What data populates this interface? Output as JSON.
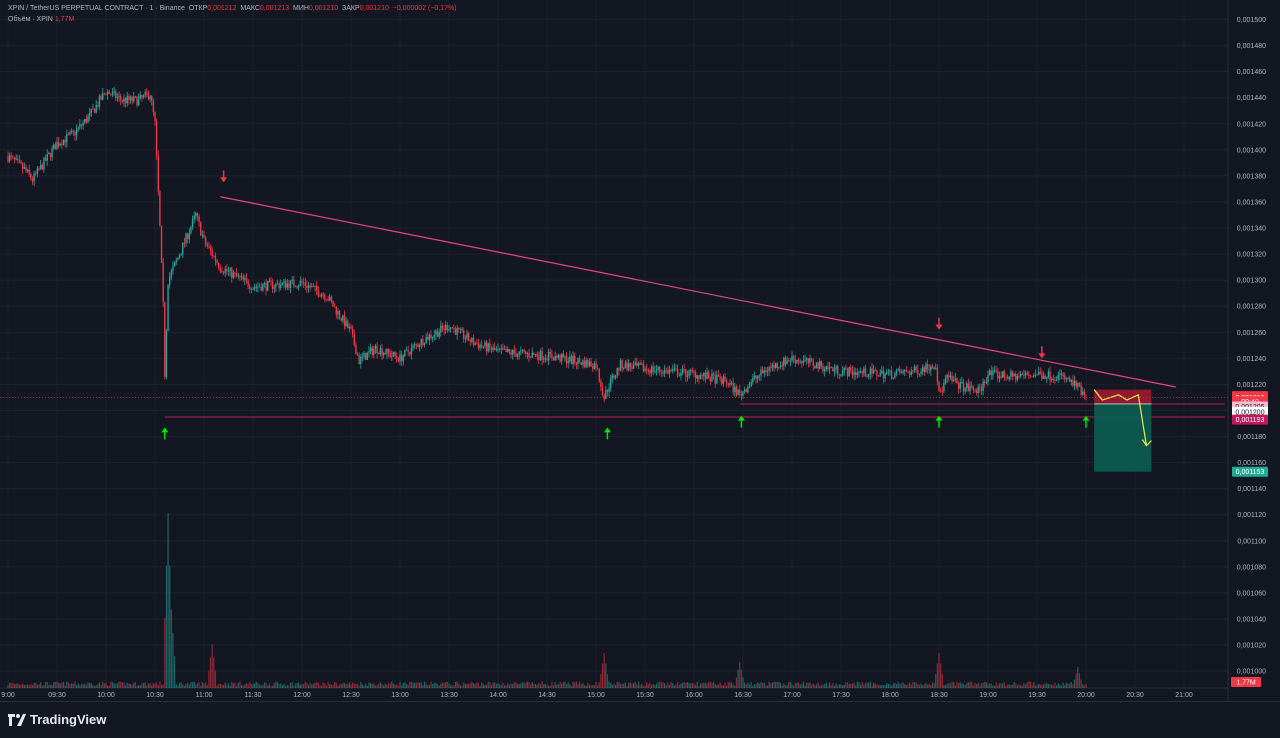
{
  "header": {
    "symbol": "XPIN / TetherUS PERPETUAL CONTRACT · 1 · Binance",
    "open_label": "ОТКР",
    "open_value": "0,001212",
    "high_label": "МАКС",
    "high_value": "0,001213",
    "low_label": "МИН",
    "low_value": "0,001210",
    "close_label": "ЗАКР",
    "close_value": "0,001210",
    "change": "−0,000002 (−0,17%)",
    "volume_label": "Объём · XPIN",
    "volume_value": "1,77M"
  },
  "brand": {
    "name": "TradingView",
    "icon": "tradingview-logo-icon"
  },
  "colors": {
    "background": "#131722",
    "grid": "#1e222d",
    "up": "#26a69a",
    "down": "#f23645",
    "trendline": "#e8477d",
    "level": "#c2185b",
    "up_arrow": "#00e600",
    "down_arrow": "#f23645",
    "forecast": "#f5e642",
    "stop_zone": "#b71c35",
    "target_zone": "#0b5d52"
  },
  "chart_data": {
    "type": "candlestick",
    "title": "XPIN / TetherUS PERPETUAL CONTRACT · 1 · Binance",
    "y_ticks": [
      "0,001500",
      "0,001480",
      "0,001460",
      "0,001440",
      "0,001420",
      "0,001400",
      "0,001380",
      "0,001360",
      "0,001340",
      "0,001320",
      "0,001300",
      "0,001280",
      "0,001260",
      "0,001240",
      "0,001220",
      "0,001200",
      "0,001180",
      "0,001160",
      "0,001140",
      "0,001120",
      "0,001100",
      "0,001080",
      "0,001060",
      "0,001040",
      "0,001020",
      "0,001000"
    ],
    "ylim": [
      0.000987,
      0.001515
    ],
    "y_tick_values": [
      0.0015,
      0.00148,
      0.00146,
      0.00144,
      0.00142,
      0.0014,
      0.00138,
      0.00136,
      0.00134,
      0.00132,
      0.0013,
      0.00128,
      0.00126,
      0.00124,
      0.00122,
      0.0012,
      0.00118,
      0.00116,
      0.00114,
      0.00112,
      0.0011,
      0.00108,
      0.00106,
      0.00104,
      0.00102,
      0.001
    ],
    "x_ticks": [
      "9:00",
      "09:30",
      "10:00",
      "10:30",
      "11:00",
      "11:30",
      "12:00",
      "12:30",
      "13:00",
      "13:30",
      "14:00",
      "14:30",
      "15:00",
      "15:30",
      "16:00",
      "16:30",
      "17:00",
      "17:30",
      "18:00",
      "18:30",
      "19:00",
      "19:30",
      "20:00",
      "20:30",
      "21:00"
    ],
    "price_path": [
      [
        "9:00",
        0.001395
      ],
      [
        "9:10",
        0.001385
      ],
      [
        "9:15",
        0.001377
      ],
      [
        "9:30",
        0.001405
      ],
      [
        "9:40",
        0.001412
      ],
      [
        "9:50",
        0.001426
      ],
      [
        "10:00",
        0.001445
      ],
      [
        "10:10",
        0.001438
      ],
      [
        "10:20",
        0.001438
      ],
      [
        "10:27",
        0.001443
      ],
      [
        "10:30",
        0.00142
      ],
      [
        "10:33",
        0.00134
      ],
      [
        "10:35",
        0.00128
      ],
      [
        "10:36",
        0.001228
      ],
      [
        "10:38",
        0.0013
      ],
      [
        "10:45",
        0.00132
      ],
      [
        "10:55",
        0.00135
      ],
      [
        "11:00",
        0.00133
      ],
      [
        "11:05",
        0.00132
      ],
      [
        "11:10",
        0.00131
      ],
      [
        "11:30",
        0.001295
      ],
      [
        "12:00",
        0.001298
      ],
      [
        "12:15",
        0.001288
      ],
      [
        "12:30",
        0.00126
      ],
      [
        "12:35",
        0.001238
      ],
      [
        "12:45",
        0.001248
      ],
      [
        "13:00",
        0.00124
      ],
      [
        "13:15",
        0.001255
      ],
      [
        "13:30",
        0.001265
      ],
      [
        "13:45",
        0.001252
      ],
      [
        "14:00",
        0.001245
      ],
      [
        "14:30",
        0.001242
      ],
      [
        "15:00",
        0.001235
      ],
      [
        "15:05",
        0.00121
      ],
      [
        "15:08",
        0.00122
      ],
      [
        "15:15",
        0.001235
      ],
      [
        "15:30",
        0.001232
      ],
      [
        "16:00",
        0.001228
      ],
      [
        "16:20",
        0.001222
      ],
      [
        "16:28",
        0.001212
      ],
      [
        "16:35",
        0.001222
      ],
      [
        "16:45",
        0.001232
      ],
      [
        "17:00",
        0.00124
      ],
      [
        "17:15",
        0.001235
      ],
      [
        "17:30",
        0.00123
      ],
      [
        "18:00",
        0.001228
      ],
      [
        "18:15",
        0.00123
      ],
      [
        "18:28",
        0.001236
      ],
      [
        "18:30",
        0.001212
      ],
      [
        "18:35",
        0.001225
      ],
      [
        "18:45",
        0.001218
      ],
      [
        "18:55",
        0.001215
      ],
      [
        "19:00",
        0.001228
      ],
      [
        "19:15",
        0.001226
      ],
      [
        "19:30",
        0.001228
      ],
      [
        "19:45",
        0.001226
      ],
      [
        "19:55",
        0.001218
      ],
      [
        "19:58",
        0.001212
      ],
      [
        "20:00",
        0.00121
      ]
    ],
    "trendline": {
      "from": [
        "11:10",
        0.001364
      ],
      "to": [
        "20:55",
        0.001218
      ]
    },
    "levels": [
      {
        "value": 0.001205,
        "from": "16:28",
        "to": "21:25"
      },
      {
        "value": 0.001195,
        "from": "10:36",
        "to": "21:25"
      }
    ],
    "up_arrows": [
      [
        "10:36",
        0.001187
      ],
      [
        "15:07",
        0.001187
      ],
      [
        "16:29",
        0.001196
      ],
      [
        "18:30",
        0.001196
      ],
      [
        "20:00",
        0.001196
      ]
    ],
    "down_arrows": [
      [
        "11:12",
        0.001375
      ],
      [
        "18:30",
        0.001262
      ],
      [
        "19:33",
        0.00124
      ]
    ],
    "forecast": [
      [
        "20:05",
        0.001216
      ],
      [
        "20:10",
        0.001208
      ],
      [
        "20:20",
        0.001212
      ],
      [
        "20:25",
        0.001208
      ],
      [
        "20:32",
        0.001212
      ],
      [
        "20:37",
        0.001173
      ]
    ],
    "position": {
      "entry": 0.001205,
      "stop": 0.001216,
      "target": 0.001153,
      "from": "20:05",
      "to": "20:40"
    },
    "price_labels": [
      {
        "text": "0,001211",
        "value": 0.001211,
        "color": "#f23645"
      },
      {
        "text": "0,001210",
        "value": 0.00121,
        "color": "#f23645"
      },
      {
        "text": "00:40",
        "value": 0.001207,
        "color": "#f23645"
      },
      {
        "text": "0,001205",
        "value": 0.001203,
        "color": "#f8bbd0",
        "text_color": "#131722"
      },
      {
        "text": "0,001200",
        "value": 0.001199,
        "color": "#ffffff",
        "text_color": "#131722"
      },
      {
        "text": "0,001193",
        "value": 0.001193,
        "color": "#c2185b"
      },
      {
        "text": "0,001153",
        "value": 0.001153,
        "color": "#22ab94"
      }
    ],
    "volume_label": "1,77M",
    "volume_spikes": [
      [
        "10:38",
        1.0
      ],
      [
        "10:40",
        0.45
      ],
      [
        "11:05",
        0.25
      ],
      [
        "15:05",
        0.2
      ],
      [
        "16:28",
        0.15
      ],
      [
        "18:30",
        0.2
      ],
      [
        "19:55",
        0.12
      ]
    ]
  }
}
